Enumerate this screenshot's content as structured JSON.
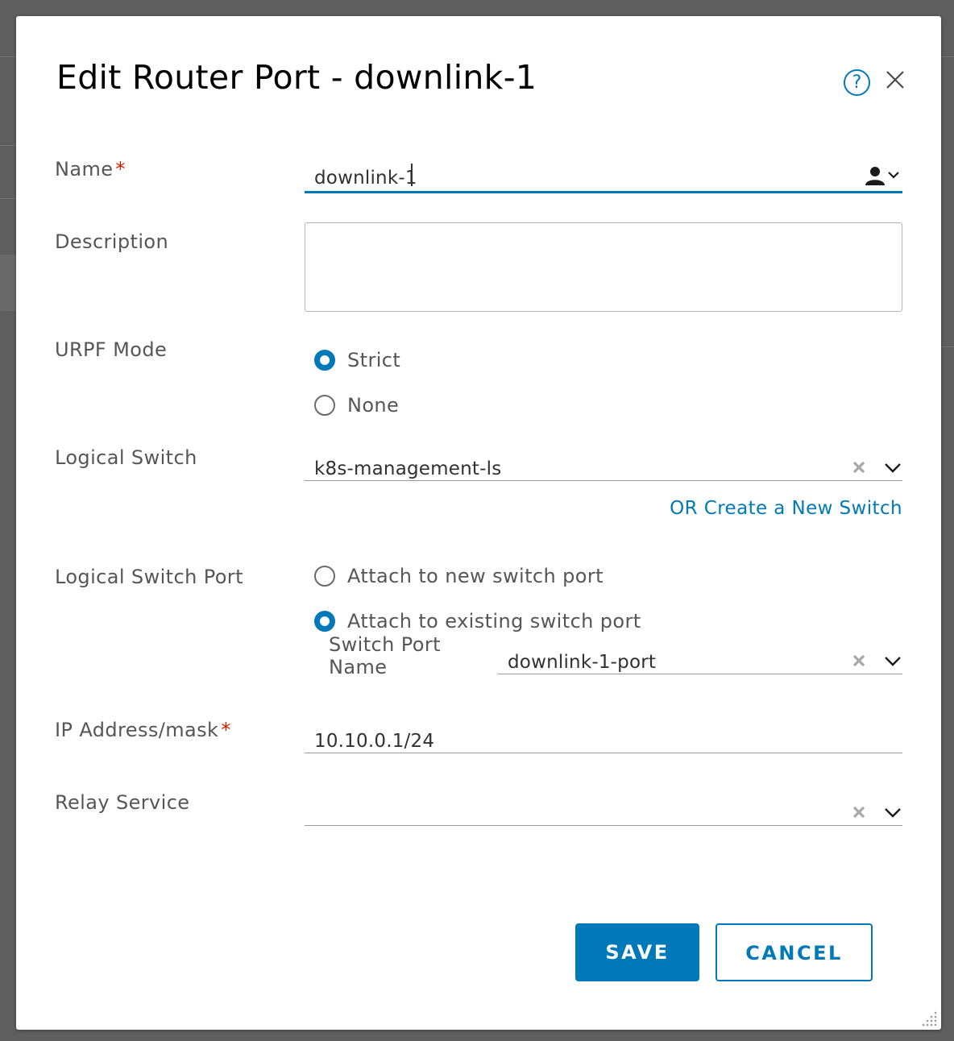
{
  "dialog": {
    "title": "Edit Router Port - downlink-1",
    "help_icon": "question-circle-icon",
    "close_icon": "close-icon",
    "help_glyph": "?"
  },
  "form": {
    "name": {
      "label": "Name",
      "required_mark": "*",
      "value": "downlink-1"
    },
    "description": {
      "label": "Description",
      "value": ""
    },
    "urpf_mode": {
      "label": "URPF Mode",
      "options": [
        {
          "label": "Strict",
          "checked": true
        },
        {
          "label": "None",
          "checked": false
        }
      ]
    },
    "logical_switch": {
      "label": "Logical Switch",
      "value": "k8s-management-ls",
      "create_link": "OR Create a New Switch"
    },
    "logical_switch_port": {
      "label": "Logical Switch Port",
      "options": [
        {
          "label": "Attach to new switch port",
          "checked": false
        },
        {
          "label": "Attach to existing switch port",
          "checked": true
        }
      ],
      "switch_port_name_label": "Switch Port Name",
      "switch_port_name_value": "downlink-1-port"
    },
    "ip_address": {
      "label": "IP Address/mask",
      "required_mark": "*",
      "value": "10.10.0.1/24"
    },
    "relay_service": {
      "label": "Relay Service",
      "value": ""
    }
  },
  "buttons": {
    "save": "SAVE",
    "cancel": "CANCEL"
  },
  "colors": {
    "accent": "#0079b8",
    "required": "#c92100",
    "overlay": "#5e5e5e"
  }
}
